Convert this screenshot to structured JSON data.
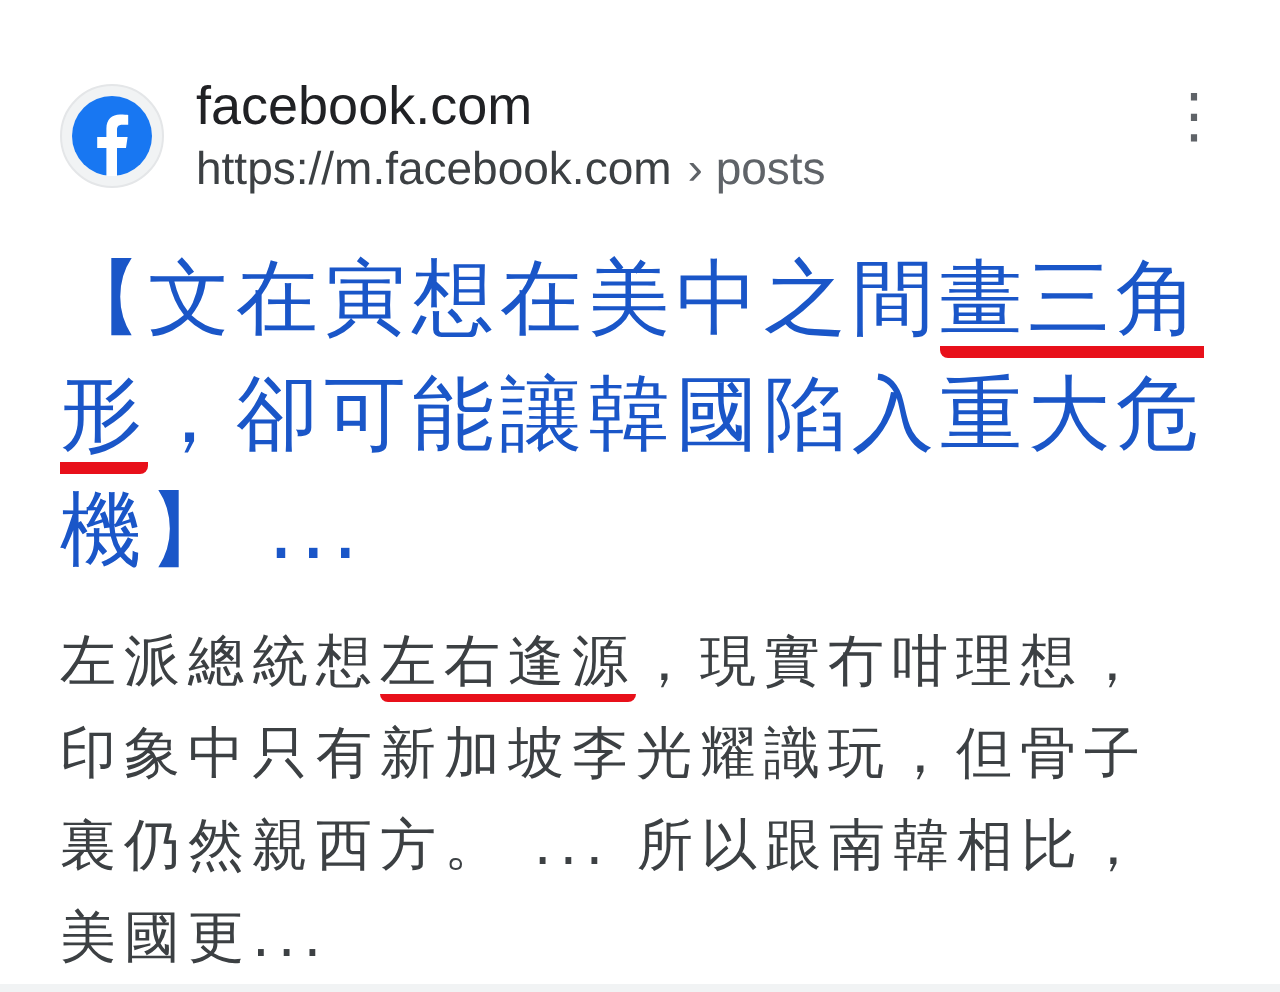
{
  "result": {
    "site_name": "facebook.com",
    "url": "https://m.facebook.com",
    "breadcrumb": "› posts",
    "more_icon": "⋮",
    "title": [
      {
        "text": "【文在寅想在美中之間",
        "underlined": false
      },
      {
        "text": "畫三角形",
        "underlined": true
      },
      {
        "text": "，卻可能讓韓國陷入重大危機】 ...",
        "underlined": false
      }
    ],
    "snippet": [
      {
        "text": "左派總統想",
        "underlined": false
      },
      {
        "text": "左右逢源",
        "underlined": true
      },
      {
        "text": "，現實冇咁理想，印象中只有新加坡李光耀識玩，但骨子裏仍然親西方。 ... 所以跟南韓相比，美國更...",
        "underlined": false
      }
    ]
  }
}
